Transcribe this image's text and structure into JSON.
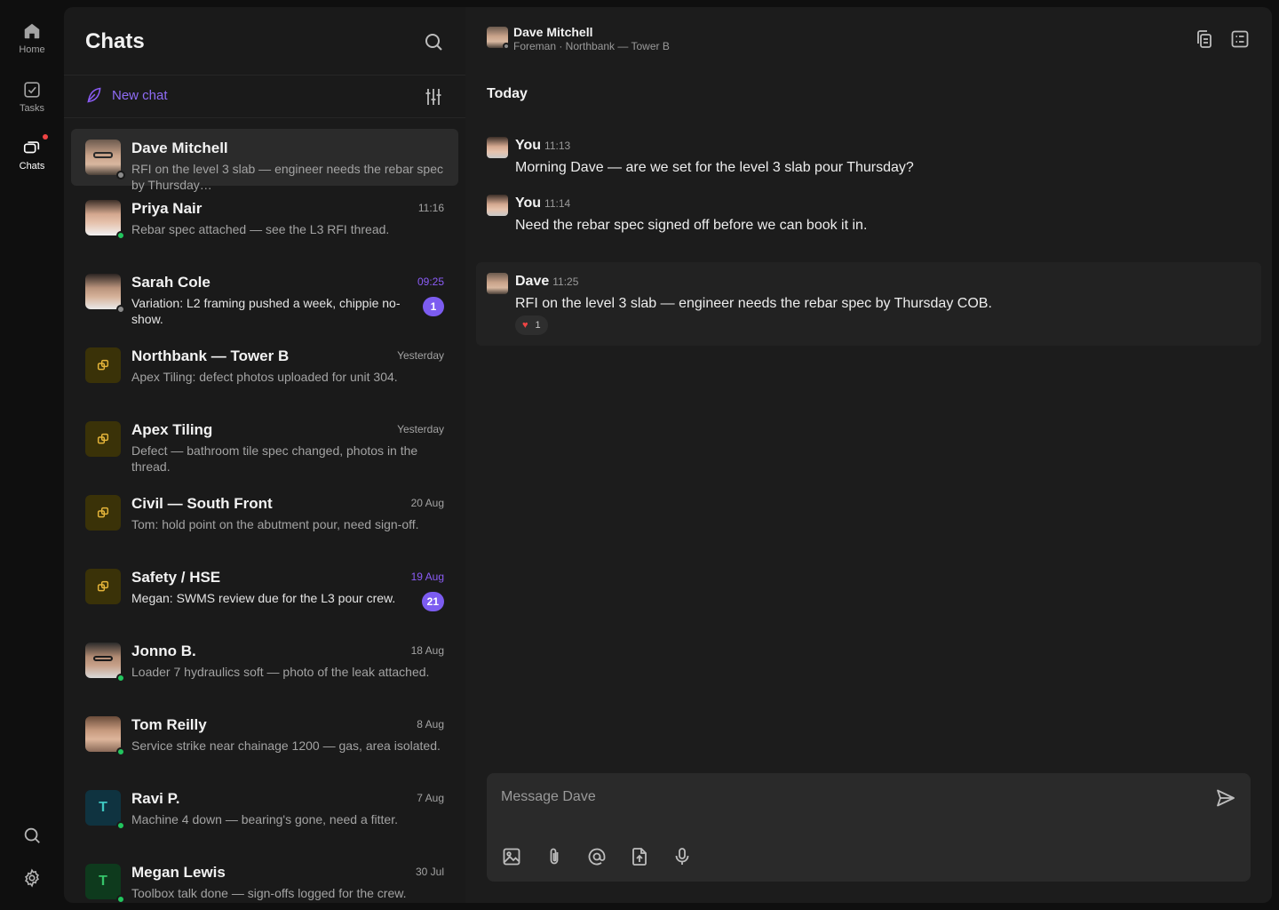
{
  "rail": {
    "home_label": "Home",
    "tasks_label": "Tasks",
    "chats_label": "Chats"
  },
  "list": {
    "title": "Chats",
    "new_chat_label": "New chat"
  },
  "chats": [
    {
      "name": "Dave Mitchell",
      "time": "",
      "preview": "RFI on the level 3 slab — engineer needs the rebar spec by Thursday…",
      "badge": "",
      "status": "away"
    },
    {
      "name": "Priya Nair",
      "time": "11:16",
      "preview": "Rebar spec attached — see the L3 RFI thread.",
      "badge": "",
      "status": "online"
    },
    {
      "name": "Sarah Cole",
      "time": "09:25",
      "preview": "Variation: L2 framing pushed a week, chippie no-show.",
      "badge": "1",
      "status": "away"
    },
    {
      "name": "Northbank — Tower B",
      "time": "Yesterday",
      "preview": "Apex Tiling: defect photos uploaded for unit 304.",
      "badge": ""
    },
    {
      "name": "Apex Tiling",
      "time": "Yesterday",
      "preview": "Defect — bathroom tile spec changed, photos in the thread.",
      "badge": ""
    },
    {
      "name": "Civil — South Front",
      "time": "20 Aug",
      "preview": "Tom: hold point on the abutment pour, need sign-off.",
      "badge": ""
    },
    {
      "name": "Safety / HSE",
      "time": "19 Aug",
      "preview": "Megan: SWMS review due for the L3 pour crew.",
      "badge": "21"
    },
    {
      "name": "Jonno B.",
      "time": "18 Aug",
      "preview": "Loader 7 hydraulics soft — photo of the leak attached.",
      "badge": "",
      "status": "online"
    },
    {
      "name": "Tom Reilly",
      "time": "8 Aug",
      "preview": "Service strike near chainage 1200 — gas, area isolated.",
      "badge": "",
      "status": "online"
    },
    {
      "name": "Ravi P.",
      "time": "7 Aug",
      "preview": "Machine 4 down — bearing's gone, need a fitter.",
      "badge": "",
      "status": "online",
      "initial": "T"
    },
    {
      "name": "Megan Lewis",
      "time": "30 Jul",
      "preview": "Toolbox talk done — sign-offs logged for the crew.",
      "badge": "",
      "status": "online",
      "initial": "T"
    }
  ],
  "conversation": {
    "name": "Dave Mitchell",
    "subtitle": "Foreman · Northbank — Tower B",
    "day": "Today",
    "messages": [
      {
        "author": "You",
        "time": "11:13",
        "text": "Morning Dave — are we set for the level 3 slab pour Thursday?"
      },
      {
        "author": "You",
        "time": "11:14",
        "text": "Need the rebar spec signed off before we can book it in."
      },
      {
        "author": "Dave",
        "time": "11:25",
        "text": "RFI on the level 3 slab — engineer needs the rebar spec by Thursday COB.",
        "reaction_count": "1"
      }
    ],
    "composer_placeholder": "Message Dave"
  },
  "colors": {
    "accent": "#8b5cf6",
    "online": "#22c55e",
    "alert": "#ef4444",
    "group_icon": "#e5b53a"
  }
}
